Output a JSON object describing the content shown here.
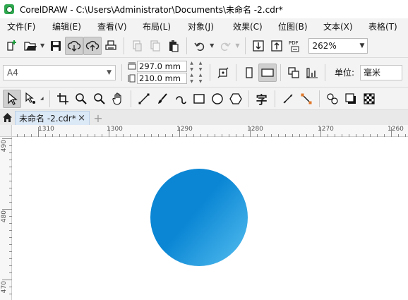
{
  "window": {
    "title": "CorelDRAW - C:\\Users\\Administrator\\Documents\\未命名 -2.cdr*"
  },
  "menu": [
    "文件(F)",
    "编辑(E)",
    "查看(V)",
    "布局(L)",
    "对象(J)",
    "效果(C)",
    "位图(B)",
    "文本(X)",
    "表格(T)"
  ],
  "standard_toolbar": {
    "zoom_level": "262%",
    "pdf_label": "PDF"
  },
  "property_bar": {
    "paper_size": "A4",
    "width": "297.0 mm",
    "height": "210.0 mm",
    "unit_label": "单位:",
    "unit_value": "毫米"
  },
  "toolbox": {
    "text_tool_glyph": "字"
  },
  "document_tab": {
    "name": "未命名 -2.cdr*",
    "close": "×",
    "add": "+"
  },
  "rulers": {
    "horizontal_labels": [
      "1310",
      "1300",
      "1290",
      "1280",
      "1270",
      "1260"
    ],
    "vertical_labels": [
      "490",
      "480",
      "470"
    ]
  },
  "colors": {
    "circle_fill_start": "#0a86d4",
    "circle_fill_end": "#56bff0",
    "tab_active": "#dbe8f6"
  }
}
